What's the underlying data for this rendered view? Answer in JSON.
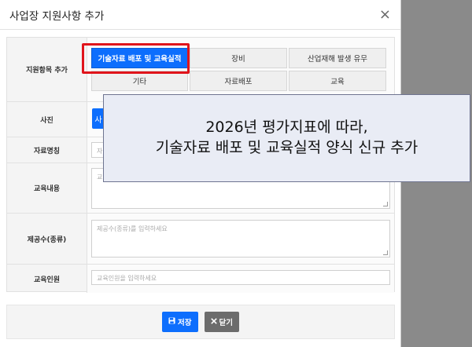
{
  "modal": {
    "title": "사업장 지원사항 추가",
    "close_glyph": "×"
  },
  "form": {
    "type_label": "지원항목 추가",
    "types": [
      "기술자료 배포 및 교육실적",
      "장비",
      "산업재해 발생 유무",
      "기타",
      "자료배포",
      "교육"
    ],
    "active_type": "기술자료 배포 및 교육실적",
    "photo_label": "사진",
    "photo_button_glyph": "사",
    "doc_name_label": "자료명칭",
    "doc_name_placeholder": "자",
    "edu_content_label": "교육내용",
    "edu_content_placeholder": "교",
    "supply_label": "제공수(종류)",
    "supply_placeholder": "제공수(종류)를 입력하세요",
    "edu_people_label": "교육인원",
    "edu_people_placeholder": "교육인원을 입력하세요"
  },
  "footer": {
    "save_label": "저장",
    "close_label": "닫기",
    "save_icon": "floppy-disk-icon",
    "close_icon": "x-icon"
  },
  "callout": {
    "line1": "2026년 평가지표에 따라,",
    "line2": "기술자료 배포 및 교육실적 양식 신규 추가"
  },
  "colors": {
    "primary": "#0d6efd",
    "highlight": "#e0141b",
    "secondary": "#6c6c6c"
  }
}
